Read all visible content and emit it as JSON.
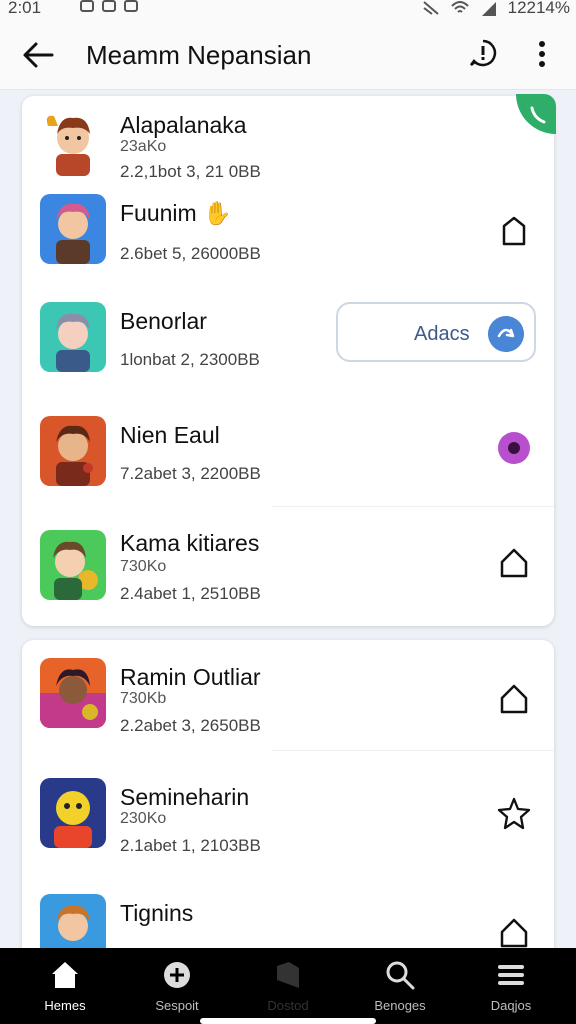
{
  "status": {
    "time": "2:01",
    "battery": "12214%"
  },
  "app_bar": {
    "title": "Meamm Nepansian"
  },
  "games": [
    {
      "name": "Alapalanaka",
      "sub": "23aKo",
      "meta": "2.2,1bot 3, 21 0BB"
    },
    {
      "name": "Fuunim",
      "sub": "",
      "meta": "2.6bet 5, 26000BB"
    },
    {
      "name": "Benorlar",
      "sub": "",
      "meta": "1lonbat 2, 2300BB"
    },
    {
      "name": "Nien Eaul",
      "sub": "",
      "meta": "7.2abet 3, 2200BB"
    },
    {
      "name": "Kama kitiares",
      "sub": "730Ko",
      "meta": "2.4abet 1, 2510BB"
    },
    {
      "name": "Ramin Outliar",
      "sub": "730Kb",
      "meta": "2.2abet 3, 2650BB"
    },
    {
      "name": "Semineharin",
      "sub": "230Ko",
      "meta": "2.1abet 1, 2103BB"
    },
    {
      "name": "Tignins",
      "sub": "",
      "meta": ""
    }
  ],
  "add_button": {
    "label": "Adacs"
  },
  "nav": [
    {
      "label": "Hemes"
    },
    {
      "label": "Sespoit"
    },
    {
      "label": "Dostod"
    },
    {
      "label": "Benoges"
    },
    {
      "label": "Daqjos"
    }
  ],
  "colors": {
    "accent": "#4a86d6",
    "corner_badge": "#2fae6a",
    "purple": "#b84fcf"
  }
}
